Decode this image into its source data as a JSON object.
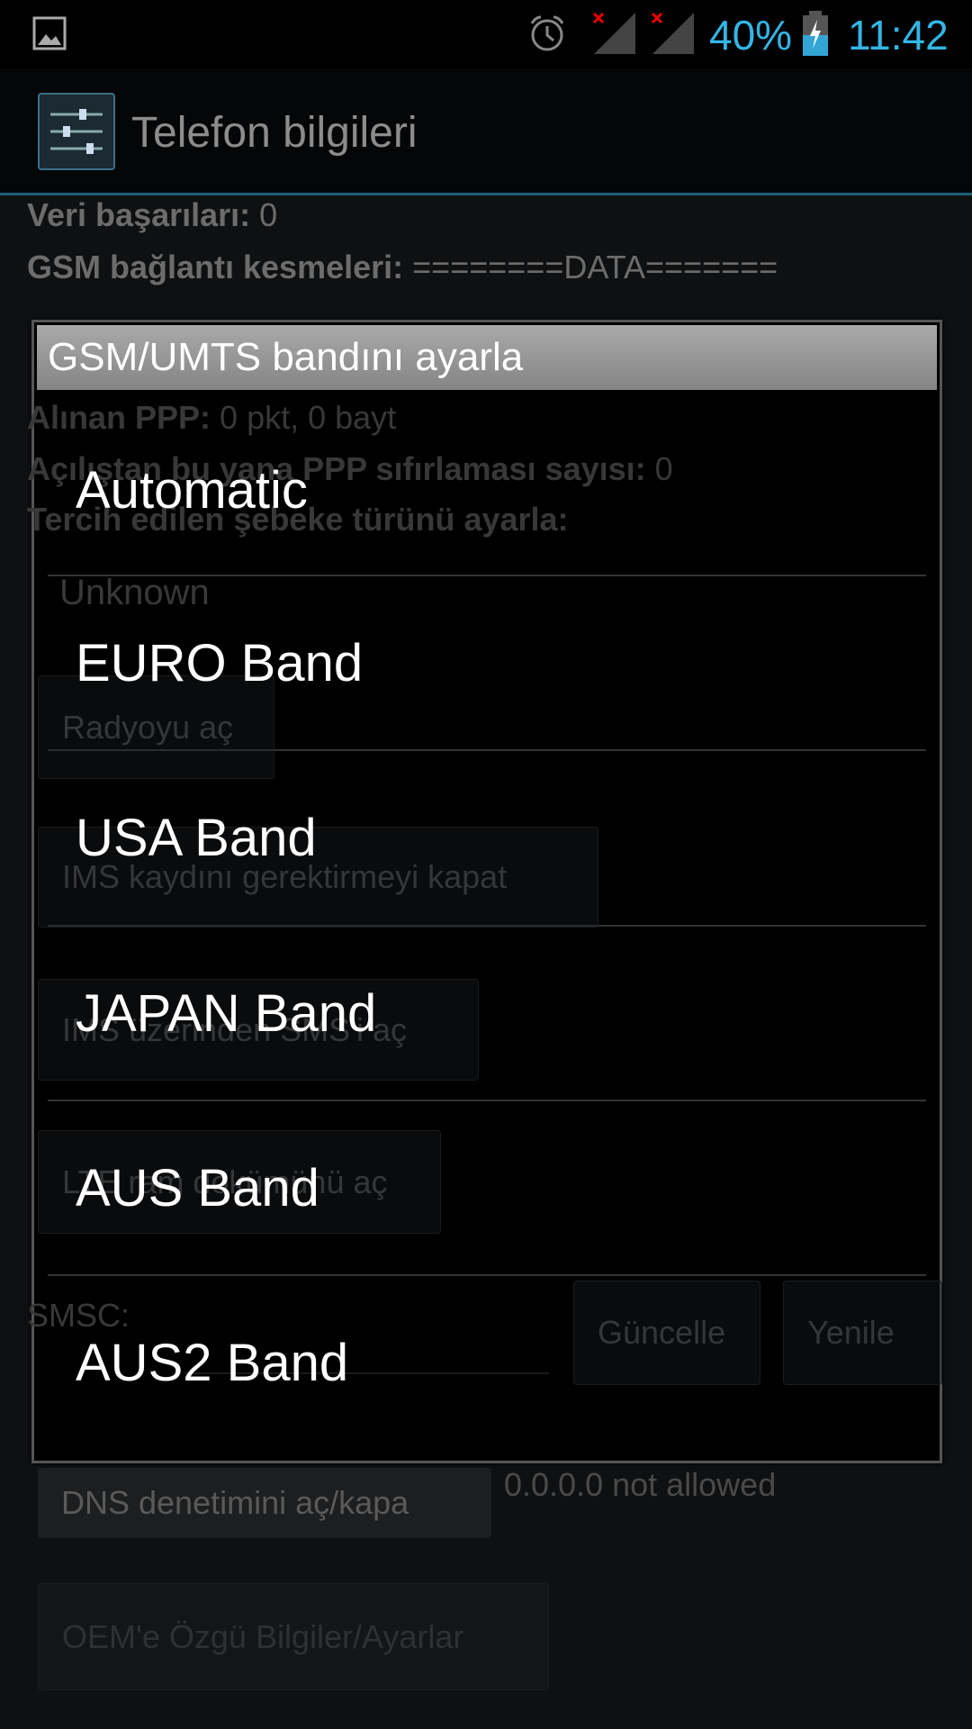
{
  "status_bar": {
    "icons": [
      "image-notification-icon",
      "alarm-icon",
      "signal-no-service-icon",
      "signal-no-service-icon",
      "battery-charging-icon"
    ],
    "battery_percent": "40%",
    "battery_level": 0.4,
    "time": "11:42",
    "accent_color": "#33b5e5"
  },
  "action_bar": {
    "icon": "settings-sliders-icon",
    "title": "Telefon bilgileri"
  },
  "background": {
    "data_success_label": "Veri başarıları:",
    "data_success_value": "0",
    "gsm_disconnect_label": "GSM bağlantı kesmeleri:",
    "gsm_disconnect_value": "========DATA=======",
    "ppp_received_label": "Alınan PPP:",
    "ppp_received_value": "0 pkt, 0 bayt",
    "ppp_reset_label": "Açılıştan bu yana PPP sıfırlaması sayısı:",
    "ppp_reset_value": "0",
    "preferred_network_label": "Tercih edilen şebeke türünü ayarla:",
    "preferred_network_value": "Unknown",
    "radio_button": "Radyoyu aç",
    "ims_registration_button": "IMS kaydını gerektirmeyi kapat",
    "ims_sms_button": "IMS üzerinden SMS'i aç",
    "lte_ram_dump_button": "LTE ram dökümünü aç",
    "smsc_label": "SMSC:",
    "smsc_value": "",
    "update_button": "Güncelle",
    "refresh_button": "Yenile",
    "dns_button": "DNS denetimini aç/kapa",
    "dns_status": "0.0.0.0 not allowed",
    "oem_button": "OEM'e Özgü Bilgiler/Ayarlar"
  },
  "dialog": {
    "title": "GSM/UMTS bandını ayarla",
    "options": [
      "Automatic",
      "EURO Band",
      "USA Band",
      "JAPAN Band",
      "AUS Band",
      "AUS2 Band"
    ]
  }
}
